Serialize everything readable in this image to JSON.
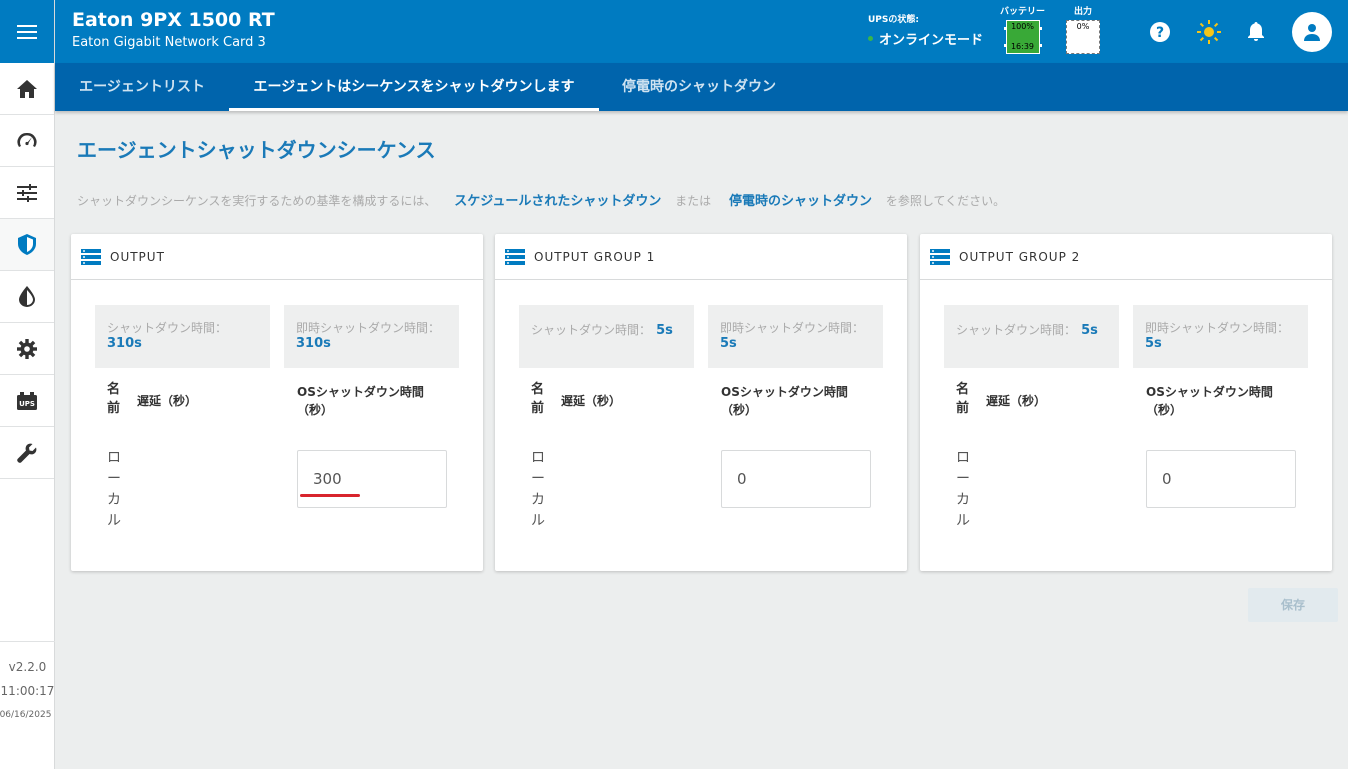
{
  "app": {
    "title": "Eaton 9PX 1500 RT",
    "subtitle": "Eaton Gigabit Network Card 3"
  },
  "status": {
    "ups_label": "UPSの状態:",
    "ups_value": "オンラインモード",
    "battery_label": "バッテリー",
    "battery_percent": "100%",
    "battery_time": "16:39",
    "output_label": "出力",
    "output_percent": "0%"
  },
  "colors": {
    "brand": "#007bc1",
    "tab_bar": "#0064ac",
    "link": "#1a7ab8",
    "battery": "#39a937",
    "online_dot": "#39b54a",
    "red_mark": "#d8242d"
  },
  "sidebar": {
    "items": [
      {
        "icon": "home-icon"
      },
      {
        "icon": "gauge-icon"
      },
      {
        "icon": "sliders-icon"
      },
      {
        "icon": "shield-icon",
        "active": true
      },
      {
        "icon": "drop-icon"
      },
      {
        "icon": "gear-icon"
      },
      {
        "icon": "ups-icon",
        "text": "UPS"
      },
      {
        "icon": "wrench-icon"
      }
    ],
    "version": "v2.2.0",
    "time": "11:00:17",
    "date": "06/16/2025"
  },
  "tabs": [
    {
      "label": "エージェントリスト"
    },
    {
      "label": "エージェントはシーケンスをシャットダウンします",
      "active": true
    },
    {
      "label": "停電時のシャットダウン"
    }
  ],
  "page": {
    "title": "エージェントシャットダウンシーケンス",
    "desc_before": "シャットダウンシーケンスを実行するための基準を構成するには、",
    "desc_link1": "スケジュールされたシャットダウン",
    "desc_mid": "または",
    "desc_link2": "停電時のシャットダウン",
    "desc_after": "を参照してください。"
  },
  "cards": [
    {
      "title": "OUTPUT",
      "shutdown_label": "シャットダウン時間：",
      "shutdown_value": "310s",
      "immediate_label": "即時シャットダウン時間：",
      "immediate_value": "310s",
      "col_name": "名前",
      "col_delay": "遅延（秒）",
      "col_os": "OSシャットダウン時間（秒）",
      "agent_name": "ローカル",
      "os_value": "300",
      "marked": true
    },
    {
      "title": "OUTPUT GROUP 1",
      "shutdown_label": "シャットダウン時間：",
      "shutdown_value": "5s",
      "immediate_label": "即時シャットダウン時間：",
      "immediate_value": "5s",
      "col_name": "名前",
      "col_delay": "遅延（秒）",
      "col_os": "OSシャットダウン時間（秒）",
      "agent_name": "ローカル",
      "os_value": "0",
      "marked": false
    },
    {
      "title": "OUTPUT GROUP 2",
      "shutdown_label": "シャットダウン時間：",
      "shutdown_value": "5s",
      "immediate_label": "即時シャットダウン時間：",
      "immediate_value": "5s",
      "col_name": "名前",
      "col_delay": "遅延（秒）",
      "col_os": "OSシャットダウン時間（秒）",
      "agent_name": "ローカル",
      "os_value": "0",
      "marked": false
    }
  ],
  "buttons": {
    "save": "保存"
  }
}
